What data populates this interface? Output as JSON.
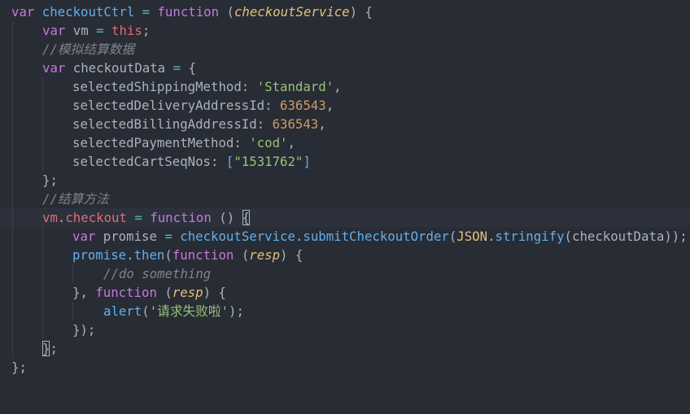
{
  "editor": {
    "theme": "one-dark",
    "colors": {
      "background": "#282c34",
      "keyword": "#c678dd",
      "function": "#61afef",
      "variable": "#e06c75",
      "string": "#98c379",
      "number": "#d19a66",
      "comment": "#7f848e",
      "class": "#e5c07b",
      "plain": "#abb2bf"
    },
    "lines": [
      {
        "text": "var checkoutCtrl = function (checkoutService) {"
      },
      {
        "text": "var vm = this;"
      },
      {
        "text": "//模拟结算数据"
      },
      {
        "text": "var checkoutData = {"
      },
      {
        "text": "selectedShippingMethod: 'Standard',"
      },
      {
        "text": "selectedDeliveryAddressId: 636543,"
      },
      {
        "text": "selectedBillingAddressId: 636543,"
      },
      {
        "text": "selectedPaymentMethod: 'cod',"
      },
      {
        "text": "selectedCartSeqNos: [\"1531762\"]"
      },
      {
        "text": "};"
      },
      {
        "text": "//结算方法"
      },
      {
        "text": "vm.checkout = function () {"
      },
      {
        "text": "var promise = checkoutService.submitCheckoutOrder(JSON.stringify(checkoutData));"
      },
      {
        "text": "promise.then(function (resp) {"
      },
      {
        "text": "//do something"
      },
      {
        "text": "}, function (resp) {"
      },
      {
        "text": "alert('请求失败啦');"
      },
      {
        "text": "});"
      },
      {
        "text": "};"
      },
      {
        "text": "};"
      }
    ],
    "tokens": {
      "l1": {
        "var": "var",
        "name": "checkoutCtrl",
        "eq": " = ",
        "function": "function",
        "paren_open": " (",
        "param": "checkoutService",
        "paren_close": ") {"
      },
      "l2": {
        "var": "var",
        "name": " vm ",
        "eq": "=",
        "this": " this",
        "semi": ";"
      },
      "l3": {
        "comment": "//模拟结算数据"
      },
      "l4": {
        "var": "var",
        "name": " checkoutData ",
        "eq": "=",
        "brace": " {"
      },
      "l5": {
        "key": "selectedShippingMethod: ",
        "val": "'Standard'",
        "comma": ","
      },
      "l6": {
        "key": "selectedDeliveryAddressId: ",
        "val": "636543",
        "comma": ","
      },
      "l7": {
        "key": "selectedBillingAddressId: ",
        "val": "636543",
        "comma": ","
      },
      "l8": {
        "key": "selectedPaymentMethod: ",
        "val": "'cod'",
        "comma": ","
      },
      "l9": {
        "key": "selectedCartSeqNos: ",
        "open": "[",
        "val": "\"1531762\"",
        "close": "]"
      },
      "l10": {
        "close": "};"
      },
      "l11": {
        "comment": "//结算方法"
      },
      "l12": {
        "obj": "vm",
        "dot": ".",
        "prop": "checkout",
        "eq": " = ",
        "function": "function",
        "parens": " () ",
        "brace": "{"
      },
      "l13": {
        "var": "var",
        "name": " promise ",
        "eq": "=",
        "svc": " checkoutService",
        "dot1": ".",
        "method": "submitCheckoutOrder",
        "p1": "(",
        "json": "JSON",
        "dot2": ".",
        "stringify": "stringify",
        "p2": "(",
        "arg": "checkoutData",
        "end": "));"
      },
      "l14": {
        "obj": "promise",
        "dot": ".",
        "then": "then",
        "p1": "(",
        "function": "function",
        "p2": " (",
        "param": "resp",
        "p3": ") {"
      },
      "l15": {
        "comment": "//do something"
      },
      "l16": {
        "close": "}, ",
        "function": "function",
        "p1": " (",
        "param": "resp",
        "p2": ") {"
      },
      "l17": {
        "alert": "alert",
        "p1": "(",
        "str": "'请求失败啦'",
        "p2": ");"
      },
      "l18": {
        "close": "});"
      },
      "l19": {
        "brace": "}",
        "semi": ";"
      },
      "l20": {
        "close": "};"
      }
    }
  }
}
